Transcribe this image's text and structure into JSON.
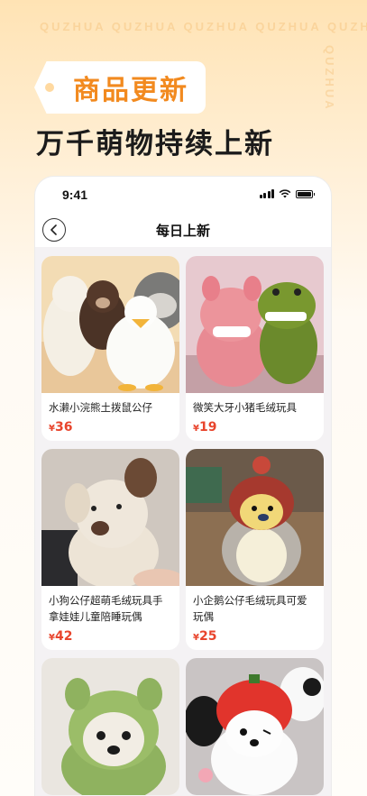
{
  "watermark": {
    "top": "QUZHUA QUZHUA QUZHUA QUZHUA QUZHUA",
    "side": "QUZHUA"
  },
  "badge": {
    "label": "商品更新"
  },
  "headline": "万千萌物持续上新",
  "phone": {
    "status_time": "9:41",
    "nav_title": "每日上新"
  },
  "products": [
    {
      "title": "水濑小浣熊土拨鼠公仔",
      "currency": "¥",
      "price": "36"
    },
    {
      "title": "微笑大牙小猪毛绒玩具",
      "currency": "¥",
      "price": "19"
    },
    {
      "title": "小狗公仔超萌毛绒玩具手拿娃娃儿童陪睡玩偶",
      "currency": "¥",
      "price": "42"
    },
    {
      "title": "小企鹅公仔毛绒玩具可爱玩偶",
      "currency": "¥",
      "price": "25"
    },
    {
      "title": "",
      "currency": "",
      "price": ""
    },
    {
      "title": "",
      "currency": "",
      "price": ""
    }
  ],
  "icons": {
    "back": "chevron-left-icon",
    "signal": "cellular-signal-icon",
    "wifi": "wifi-icon",
    "battery": "battery-icon"
  },
  "colors": {
    "accent": "#f28a1f",
    "price": "#e8442c"
  }
}
